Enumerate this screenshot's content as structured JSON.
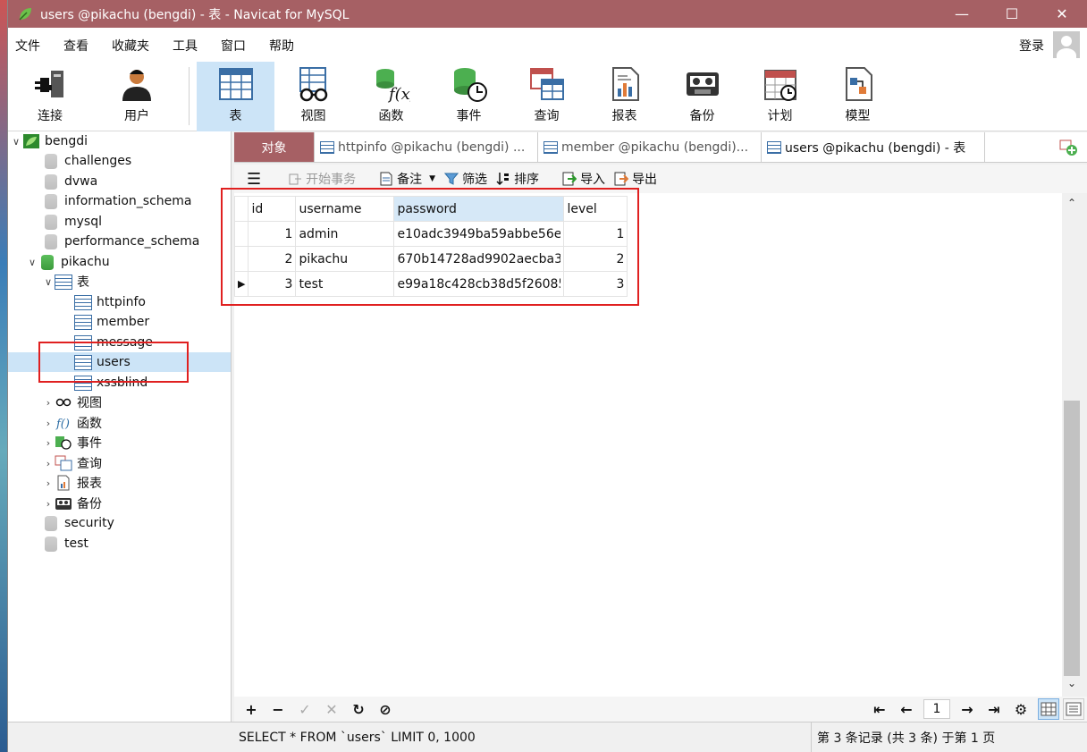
{
  "window": {
    "title": "users @pikachu (bengdi) - 表 - Navicat for MySQL"
  },
  "menu": {
    "items": [
      "文件",
      "查看",
      "收藏夹",
      "工具",
      "窗口",
      "帮助"
    ],
    "login": "登录"
  },
  "toolbar": {
    "connect": "连接",
    "user": "用户",
    "table": "表",
    "view": "视图",
    "function": "函数",
    "event": "事件",
    "query": "查询",
    "report": "报表",
    "backup": "备份",
    "schedule": "计划",
    "model": "模型"
  },
  "tree": {
    "connection": "bengdi",
    "databases_before": [
      "challenges",
      "dvwa",
      "information_schema",
      "mysql",
      "performance_schema"
    ],
    "pikachu": "pikachu",
    "tables_folder": "表",
    "tables": [
      "httpinfo",
      "member",
      "message",
      "users",
      "xssblind"
    ],
    "folders": [
      "视图",
      "函数",
      "事件",
      "查询",
      "报表",
      "备份"
    ],
    "databases_after": [
      "security",
      "test"
    ]
  },
  "tabs": {
    "objects": "对象",
    "items": [
      "httpinfo @pikachu (bengdi) ...",
      "member @pikachu (bengdi)...",
      "users @pikachu (bengdi) - 表"
    ]
  },
  "subtoolbar": {
    "begin_tx": "开始事务",
    "note": "备注",
    "filter": "筛选",
    "sort": "排序",
    "import": "导入",
    "export": "导出"
  },
  "grid": {
    "columns": [
      "id",
      "username",
      "password",
      "level"
    ],
    "rows": [
      {
        "id": "1",
        "username": "admin",
        "password": "e10adc3949ba59abbe56e",
        "level": "1"
      },
      {
        "id": "2",
        "username": "pikachu",
        "password": "670b14728ad9902aecba3",
        "level": "2"
      },
      {
        "id": "3",
        "username": "test",
        "password": "e99a18c428cb38d5f26085",
        "level": "3"
      }
    ]
  },
  "pager": {
    "page": "1"
  },
  "status": {
    "sql": "SELECT * FROM `users` LIMIT 0, 1000",
    "records": "第 3 条记录 (共 3 条) 于第 1 页"
  },
  "colors": {
    "accent": "#a66064",
    "selection": "#cce4f7",
    "annotation": "#e02020"
  }
}
